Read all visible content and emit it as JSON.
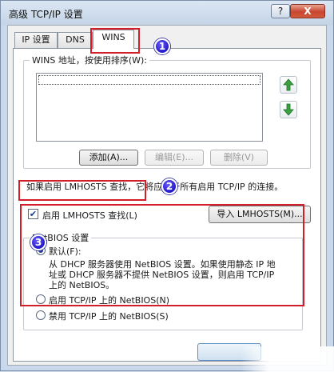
{
  "window": {
    "title": "高级 TCP/IP 设置",
    "help_label": "?",
    "close_label": "X"
  },
  "tabs": [
    {
      "label": "IP 设置"
    },
    {
      "label": "DNS"
    },
    {
      "label": "WINS"
    }
  ],
  "wins": {
    "group_label": "WINS 地址，按使用排序(W):",
    "add_button": "添加(A)...",
    "edit_button": "编辑(E)...",
    "delete_button": "删除(V)"
  },
  "lmhosts": {
    "info_text": "如果启用 LMHOSTS 查找，它将应用于所有启用 TCP/IP 的连接。",
    "checkbox_label": "启用 LMHOSTS 查找(L)",
    "checked": true,
    "import_button": "导入 LMHOSTS(M)..."
  },
  "netbios": {
    "group_label": "NetBIOS 设置",
    "default_label": "默认(F):",
    "default_desc_lines": [
      "从 DHCP 服务器使用 NetBIOS 设置。如果使用静态 IP 地",
      "址或 DHCP 服务器不提供 NetBIOS 设置，则启用 TCP/IP",
      "上的 NetBIOS。"
    ],
    "enable_label": "启用 TCP/IP 上的 NetBIOS(N)",
    "disable_label": "禁用 TCP/IP 上的 NetBIOS(S)",
    "selected": "default"
  },
  "annotations": {
    "badge1": "1",
    "badge2": "2",
    "badge3": "3",
    "highlight_color": "#d21e28"
  },
  "colors": {
    "badge_blue": "#2219c9",
    "arrow_green": "#3aa040"
  }
}
